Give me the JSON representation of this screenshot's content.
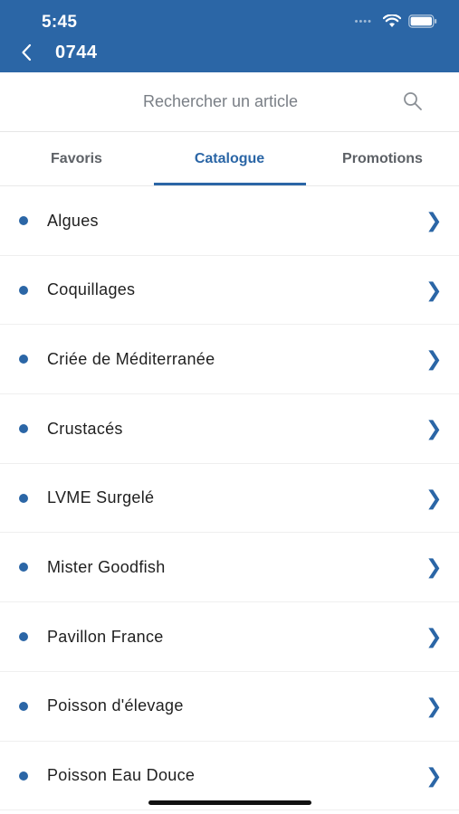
{
  "status_bar": {
    "time": "5:45"
  },
  "header": {
    "title": "0744",
    "back_icon": "chevron-left-icon"
  },
  "search": {
    "placeholder": "Rechercher un article",
    "value": "",
    "icon": "search-icon"
  },
  "tabs": [
    {
      "label": "Favoris",
      "active": false
    },
    {
      "label": "Catalogue",
      "active": true
    },
    {
      "label": "Promotions",
      "active": false
    }
  ],
  "catalogue": {
    "items": [
      {
        "label": "Algues"
      },
      {
        "label": "Coquillages"
      },
      {
        "label": "Criée de Méditerranée"
      },
      {
        "label": "Crustacés"
      },
      {
        "label": "LVME Surgelé"
      },
      {
        "label": "Mister Goodfish"
      },
      {
        "label": "Pavillon France"
      },
      {
        "label": "Poisson d'élevage"
      },
      {
        "label": "Poisson Eau Douce"
      }
    ],
    "chevron": "❯"
  },
  "colors": {
    "brand": "#2b66a6",
    "text": "#1f1f1f",
    "muted": "#5d6166"
  }
}
